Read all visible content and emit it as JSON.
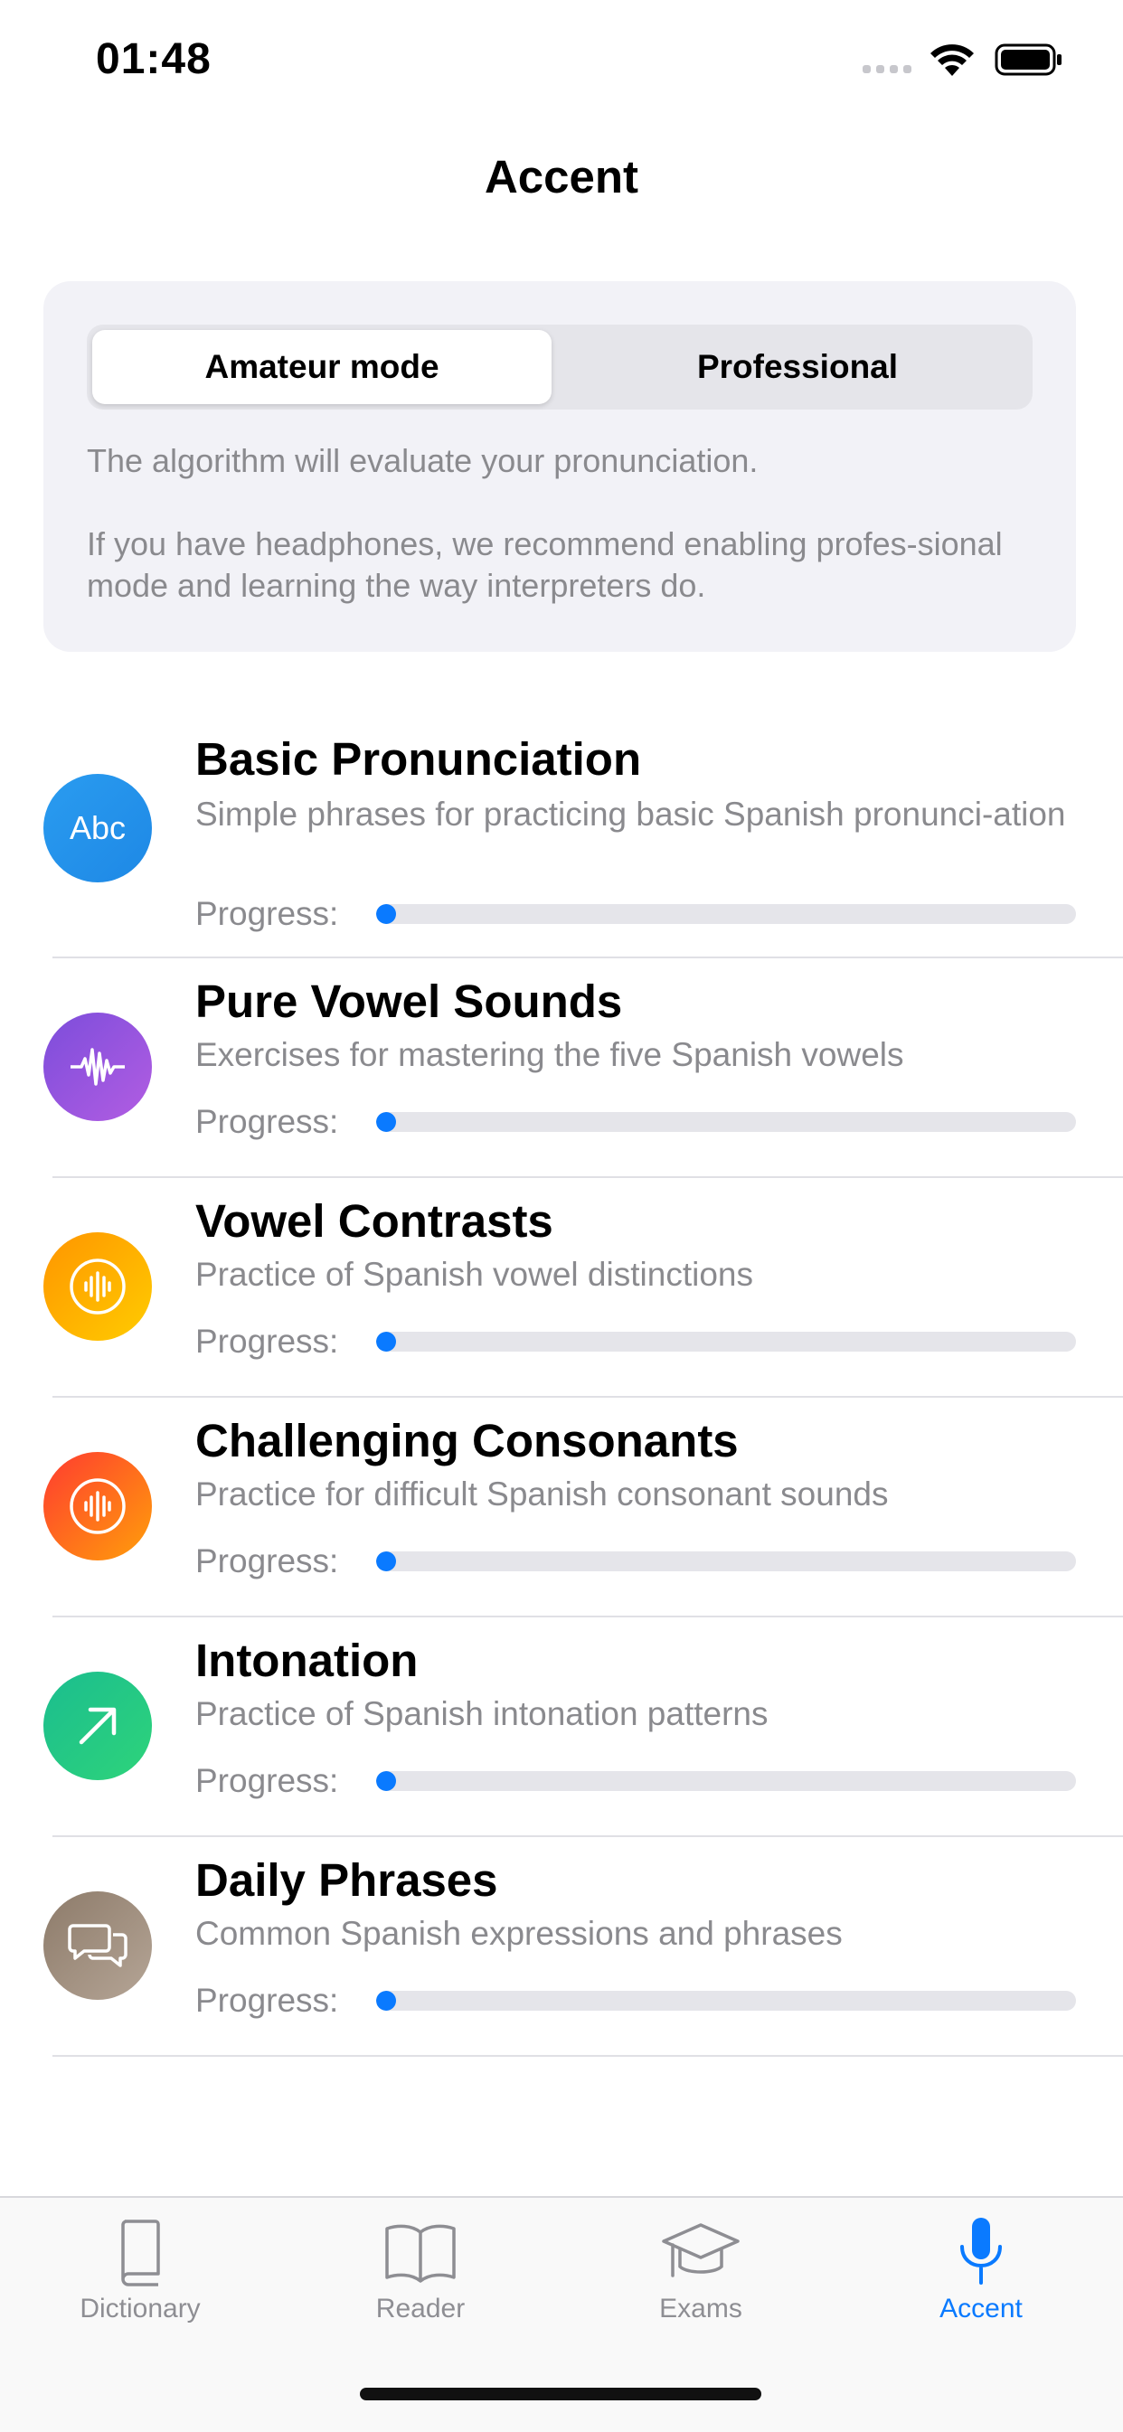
{
  "status_bar": {
    "time": "01:48"
  },
  "header": {
    "title": "Accent"
  },
  "mode_card": {
    "options": [
      "Amateur mode",
      "Professional"
    ],
    "selected": "Amateur mode",
    "desc1": "The algorithm will evaluate your pronunciation.",
    "desc2": "If you have headphones, we recommend enabling profes-sional mode and learning the way interpreters do."
  },
  "lessons": [
    {
      "title": "Basic Pronunciation",
      "desc": "Simple phrases for practicing basic Spanish pronunci-ation",
      "progress_label": "Progress:",
      "progress": 0.02,
      "icon": "abc-icon",
      "icon_text": "Abc",
      "color_a": "#2a9cf0",
      "color_b": "#1e88e5"
    },
    {
      "title": "Pure Vowel Sounds",
      "desc": "Exercises for mastering the five Spanish vowels",
      "progress_label": "Progress:",
      "progress": 0.02,
      "icon": "waveform-icon",
      "color_a": "#7c4ddb",
      "color_b": "#b25de2"
    },
    {
      "title": "Vowel Contrasts",
      "desc": "Practice of Spanish vowel distinctions",
      "progress_label": "Progress:",
      "progress": 0.02,
      "icon": "waveform-circle-icon",
      "color_a": "#ff9500",
      "color_b": "#ffcc00"
    },
    {
      "title": "Challenging Consonants",
      "desc": "Practice for difficult Spanish consonant sounds",
      "progress_label": "Progress:",
      "progress": 0.02,
      "icon": "waveform-circle-icon",
      "color_a": "#ff3b30",
      "color_b": "#ff9f0a"
    },
    {
      "title": "Intonation",
      "desc": "Practice of Spanish intonation patterns",
      "progress_label": "Progress:",
      "progress": 0.02,
      "icon": "arrow-up-right-icon",
      "color_a": "#1bbd8f",
      "color_b": "#2ed47a"
    },
    {
      "title": "Daily Phrases",
      "desc": "Common Spanish expressions and phrases",
      "progress_label": "Progress:",
      "progress": 0.02,
      "icon": "chat-bubbles-icon",
      "color_a": "#8d7b6a",
      "color_b": "#b5a596"
    }
  ],
  "tab_bar": {
    "tabs": [
      {
        "label": "Dictionary",
        "icon": "book-icon",
        "active": false
      },
      {
        "label": "Reader",
        "icon": "open-book-icon",
        "active": false
      },
      {
        "label": "Exams",
        "icon": "graduation-cap-icon",
        "active": false
      },
      {
        "label": "Accent",
        "icon": "microphone-icon",
        "active": true
      }
    ],
    "active_color": "#0a7aff",
    "inactive_color": "#8e8e93"
  }
}
